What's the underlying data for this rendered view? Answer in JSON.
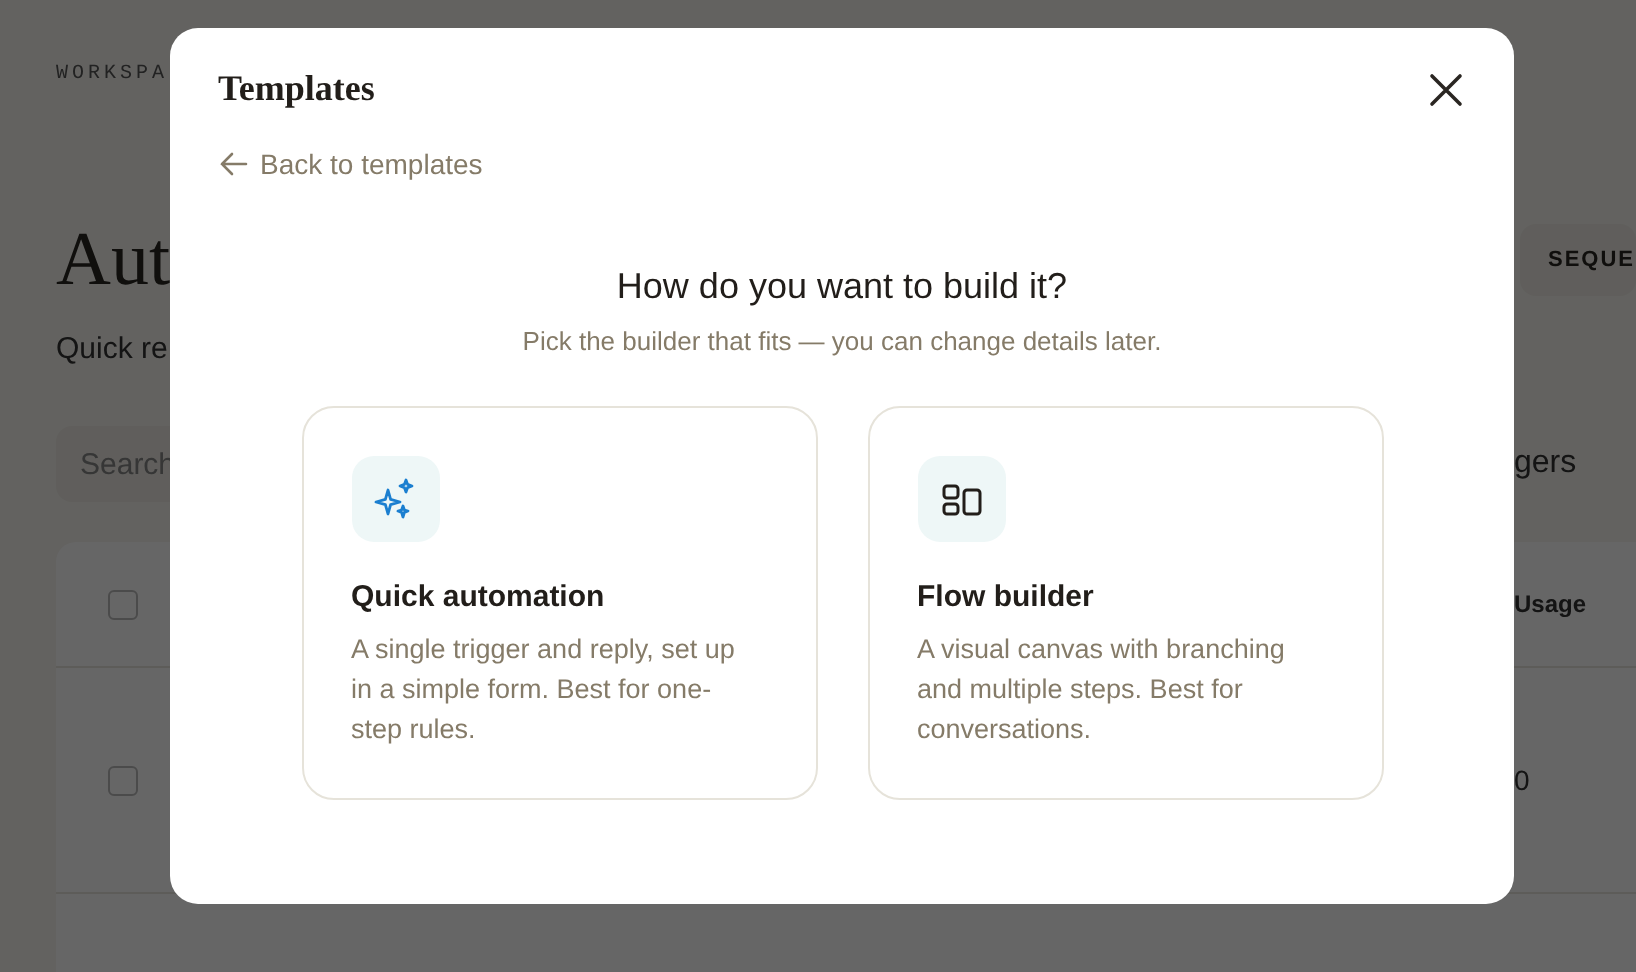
{
  "page": {
    "breadcrumb": "WORKSPA",
    "title": "Aut",
    "subtitle": "Quick re",
    "sequence_button": "SEQUE",
    "search": {
      "placeholder": "Search"
    },
    "filter": "gers",
    "table": {
      "columns": [
        {
          "label": "Usage"
        }
      ],
      "rows": [
        {
          "checked": false,
          "usage": "0"
        }
      ],
      "header_checked": false
    }
  },
  "modal": {
    "title": "Templates",
    "back_link": "Back to templates",
    "heading": "How do you want to build it?",
    "subheading": "Pick the builder that fits — you can change details later.",
    "options": [
      {
        "kind": "sparkles",
        "title": "Quick automation",
        "description": "A single trigger and reply, set up in a simple form. Best for one-step rules."
      },
      {
        "kind": "layout",
        "title": "Flow builder",
        "description": "A visual canvas with branching and multiple steps. Best for conversations."
      }
    ]
  }
}
